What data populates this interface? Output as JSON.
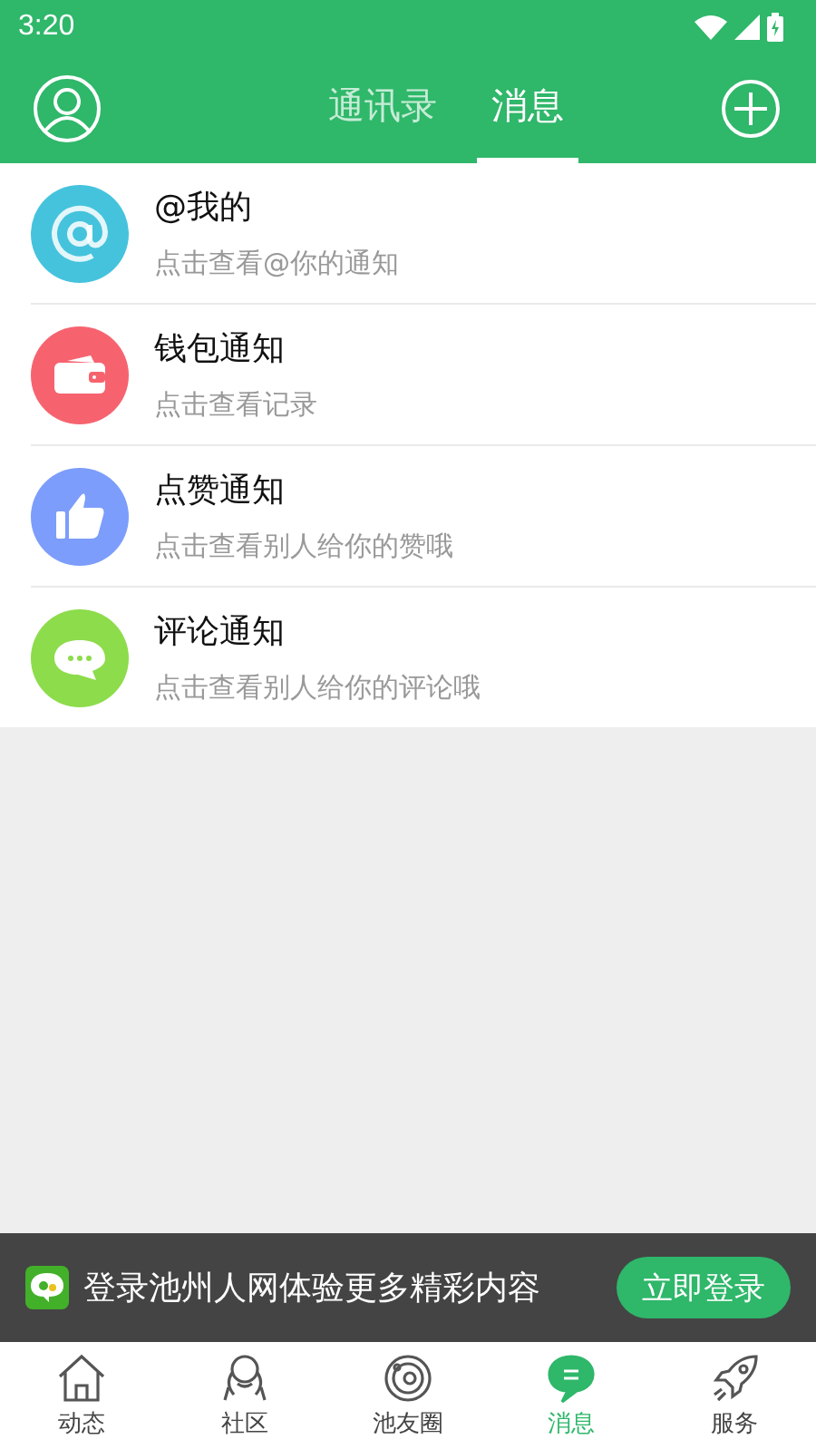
{
  "status_bar": {
    "time": "3:20"
  },
  "header": {
    "tabs": [
      {
        "label": "通讯录",
        "selected": false
      },
      {
        "label": "消息",
        "selected": true
      }
    ]
  },
  "notifications": [
    {
      "kind": "at",
      "color": "#45c3dd",
      "title": "@我的",
      "subtitle": "点击查看@你的通知"
    },
    {
      "kind": "wallet",
      "color": "#f6636f",
      "title": "钱包通知",
      "subtitle": "点击查看记录"
    },
    {
      "kind": "like",
      "color": "#7c9dfb",
      "title": "点赞通知",
      "subtitle": "点击查看别人给你的赞哦"
    },
    {
      "kind": "comment",
      "color": "#8ddc4b",
      "title": "评论通知",
      "subtitle": "点击查看别人给你的评论哦"
    }
  ],
  "login_banner": {
    "text": "登录池州人网体验更多精彩内容",
    "button": "立即登录"
  },
  "bottom_nav": [
    {
      "kind": "home",
      "label": "动态",
      "selected": false
    },
    {
      "kind": "community",
      "label": "社区",
      "selected": false
    },
    {
      "kind": "circle",
      "label": "池友圈",
      "selected": false
    },
    {
      "kind": "message",
      "label": "消息",
      "selected": true
    },
    {
      "kind": "rocket",
      "label": "服务",
      "selected": false
    }
  ]
}
